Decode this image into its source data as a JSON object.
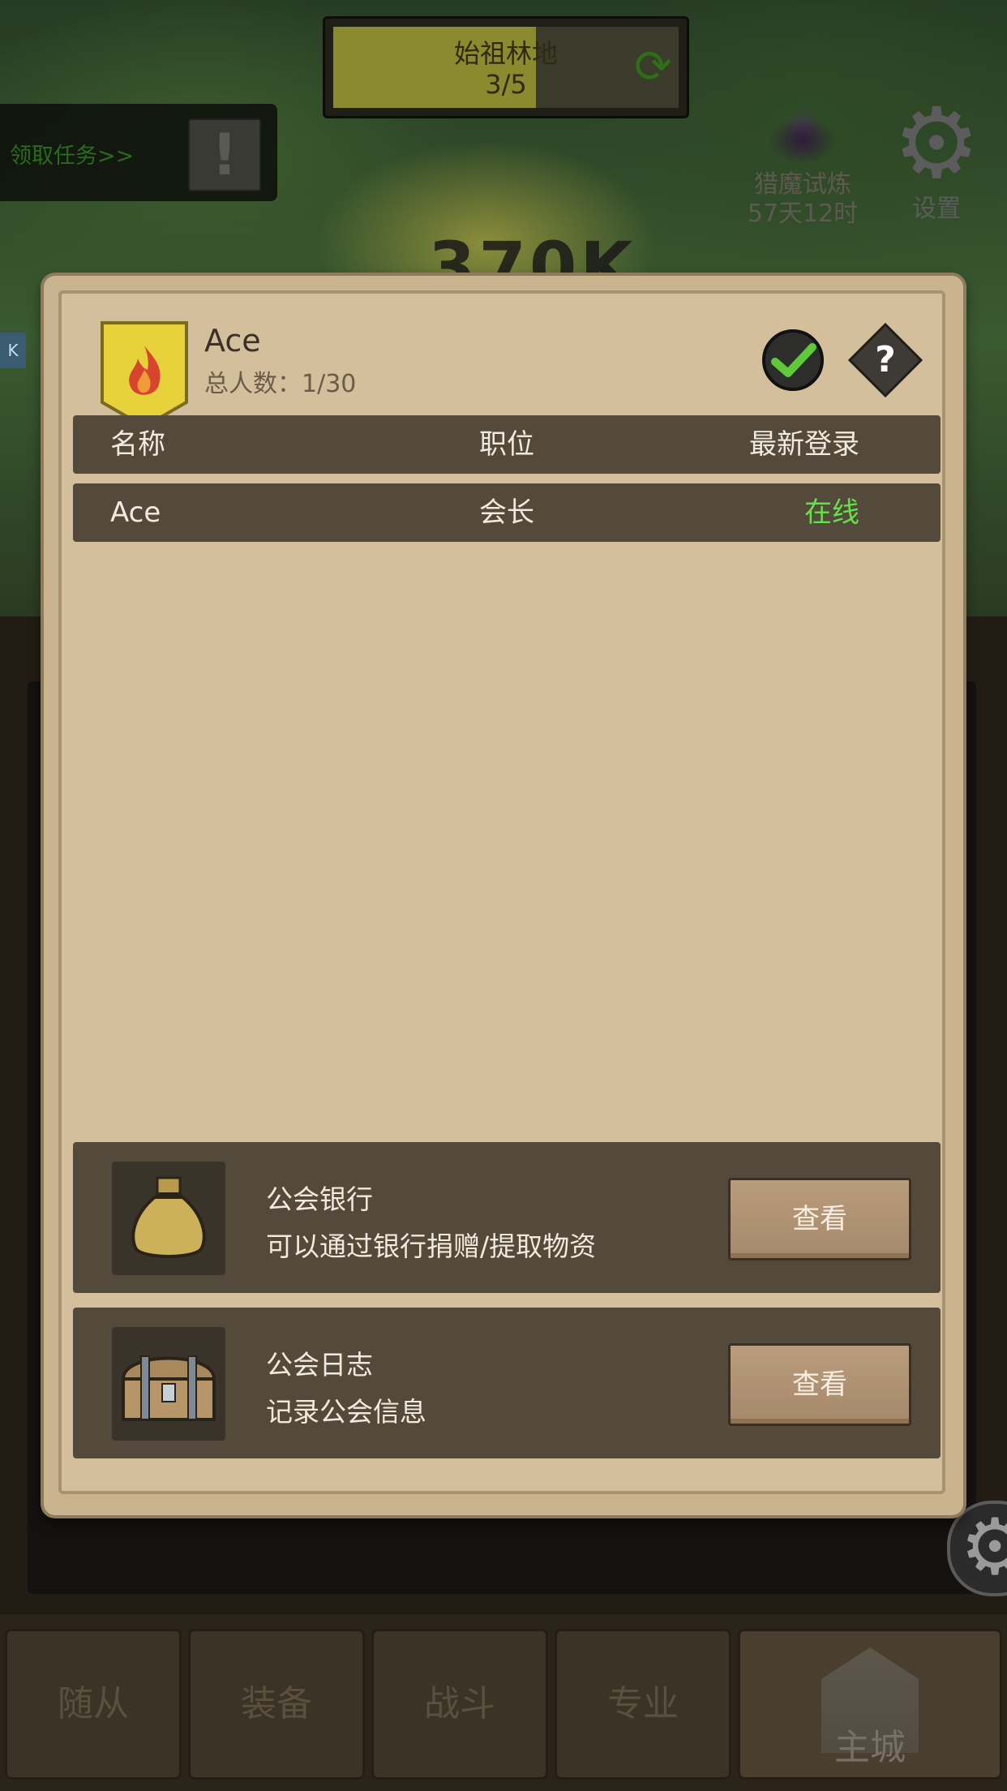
{
  "hud": {
    "zone_name": "始祖林地",
    "zone_progress": "3/5",
    "quest_prompt": "领取任务>>",
    "trial_label": "猎魔试炼",
    "trial_time": "57天12时",
    "settings_label": "设置",
    "power_value": "370K"
  },
  "guild": {
    "name": "Ace",
    "member_count_label": "总人数：",
    "member_count": "1/30",
    "columns": [
      "名称",
      "职位",
      "最新登录"
    ],
    "members": [
      {
        "name": "Ace",
        "role": "会长",
        "last_login": "在线"
      }
    ],
    "bank": {
      "title": "公会银行",
      "description": "可以通过银行捐赠/提取物资",
      "button": "查看"
    },
    "log": {
      "title": "公会日志",
      "description": "记录公会信息",
      "button": "查看"
    }
  },
  "nav": {
    "tabs": [
      "随从",
      "装备",
      "战斗",
      "专业",
      "主城"
    ]
  },
  "colors": {
    "online": "#66e04a",
    "panel": "#d4bf9c",
    "row": "#544a3c",
    "emblem": "#e8d23c"
  }
}
